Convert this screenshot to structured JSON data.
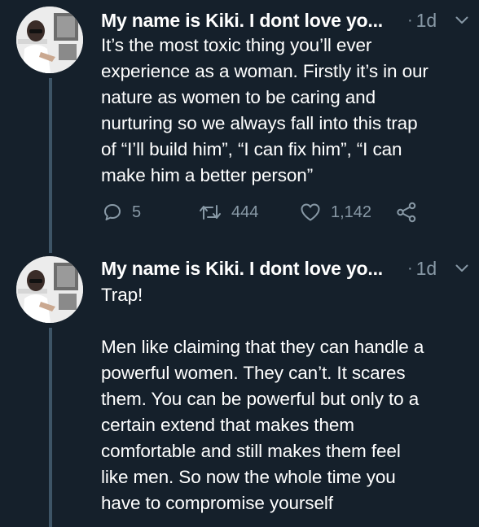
{
  "tweets": [
    {
      "author_name": "My name is Kiki. I dont love yo...",
      "separator": "·",
      "time": "1d",
      "text": "It’s the most toxic thing you’ll ever\nexperience as a woman. Firstly it’s in our\nnature as women to be caring and\nnurturing so we always fall into this trap\nof “I’ll build him”, “I can fix him”, “I can\nmake him a better person”",
      "reply_count": "5",
      "retweet_count": "444",
      "like_count": "1,142"
    },
    {
      "author_name": "My name is Kiki. I dont love yo...",
      "separator": "·",
      "time": "1d",
      "text": "Trap!\n\nMen like claiming that they can handle a\npowerful women. They can’t. It scares\nthem. You can be powerful but only to a\ncertain extend that makes them\ncomfortable and still makes them feel\nlike men. So now the whole time you\nhave to compromise yourself"
    }
  ],
  "icons": {
    "reply": "reply-bubble-icon",
    "retweet": "retweet-arrows-icon",
    "like": "heart-outline-icon",
    "share": "share-nodes-icon",
    "more": "chevron-down-icon"
  },
  "colors": {
    "background": "#15202b",
    "text": "#ffffff",
    "secondary_text": "#8899a6",
    "thread_line": "#3d5466"
  }
}
